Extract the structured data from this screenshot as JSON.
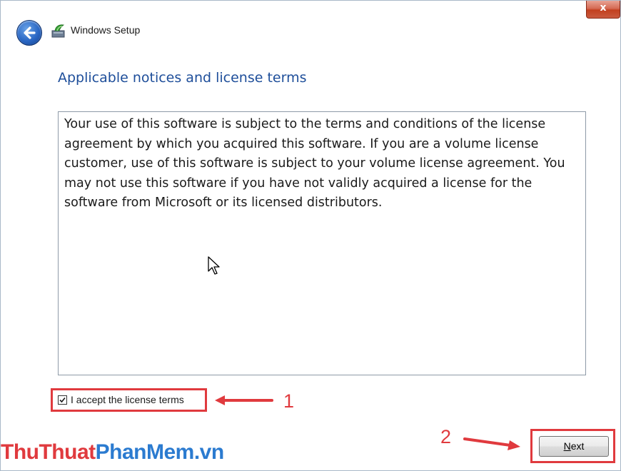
{
  "window": {
    "title": "Windows Setup",
    "close_glyph": "x"
  },
  "heading": "Applicable notices and license terms",
  "license": {
    "text": "Your use of this software is subject to the terms and conditions of the license agreement by which you acquired this software.  If you are a volume license customer, use of this software is subject to your volume license agreement.  You may not use this software if you have not validly acquired a license for the software from Microsoft or its licensed distributors."
  },
  "accept": {
    "label": "I accept the license terms",
    "checked": true
  },
  "next_button": {
    "mnemonic": "N",
    "rest": "ext"
  },
  "annotations": {
    "step1": "1",
    "step2": "2",
    "color": "#e03a3e"
  },
  "watermark": {
    "part1": "ThuThuat",
    "part2": "PhanMem",
    "part3": ".vn",
    "color1": "#e03a3e",
    "color2": "#2b7bd0"
  },
  "icons": {
    "back": "back-arrow-icon",
    "app": "windows-setup-icon",
    "cursor": "mouse-pointer-icon",
    "check": "checkmark-icon"
  }
}
